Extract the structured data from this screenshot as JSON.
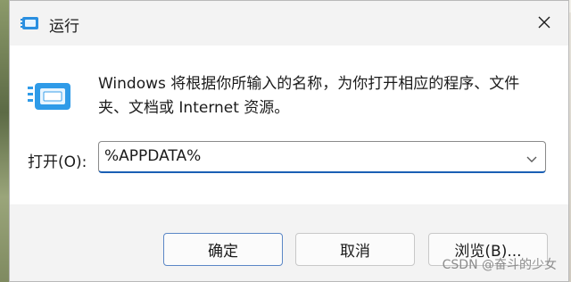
{
  "window": {
    "title": "运行",
    "description": "Windows 将根据你所输入的名称，为你打开相应的程序、文件夹、文档或 Internet 资源。"
  },
  "open_field": {
    "label": "打开(O):",
    "value": "%APPDATA%"
  },
  "buttons": {
    "ok_label": "确定",
    "cancel_label": "取消",
    "browse_label": "浏览(B)..."
  },
  "watermark": "CSDN @奋斗的少女",
  "icons": {
    "title": "run-icon",
    "close": "close-icon",
    "main": "run-window-icon",
    "dropdown": "chevron-down-icon"
  },
  "colors": {
    "accent": "#1a5fb4",
    "titlebar_bg": "#f3f3f3",
    "content_bg": "#ffffff"
  }
}
